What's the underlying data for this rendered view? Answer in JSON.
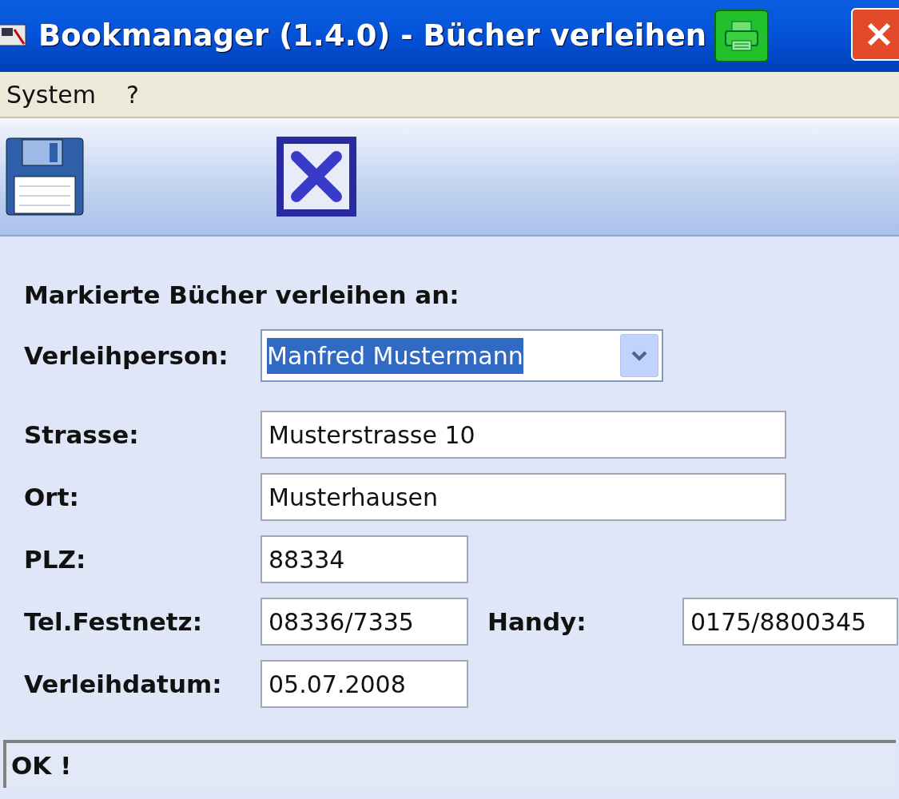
{
  "window": {
    "title": "Bookmanager (1.4.0) - Bücher verleihen"
  },
  "menu": [
    "System",
    "?"
  ],
  "form": {
    "heading": "Markierte Bücher verleihen an:",
    "person": {
      "label": "Verleihperson:",
      "value": "Manfred Mustermann",
      "highlighted": true
    },
    "fields": [
      {
        "label": "Strasse:",
        "value": "Musterstrasse 10"
      },
      {
        "label": "Ort:",
        "value": "Musterhausen"
      },
      {
        "label": "PLZ:",
        "value": "88334"
      },
      {
        "label": "Tel.Festnetz:",
        "value": "08336/7335",
        "extra": {
          "label": "Handy:",
          "value": "0175/8800345"
        }
      },
      {
        "label": "Verleihdatum:",
        "value": "05.07.2008"
      }
    ]
  },
  "status_bar": "OK !"
}
